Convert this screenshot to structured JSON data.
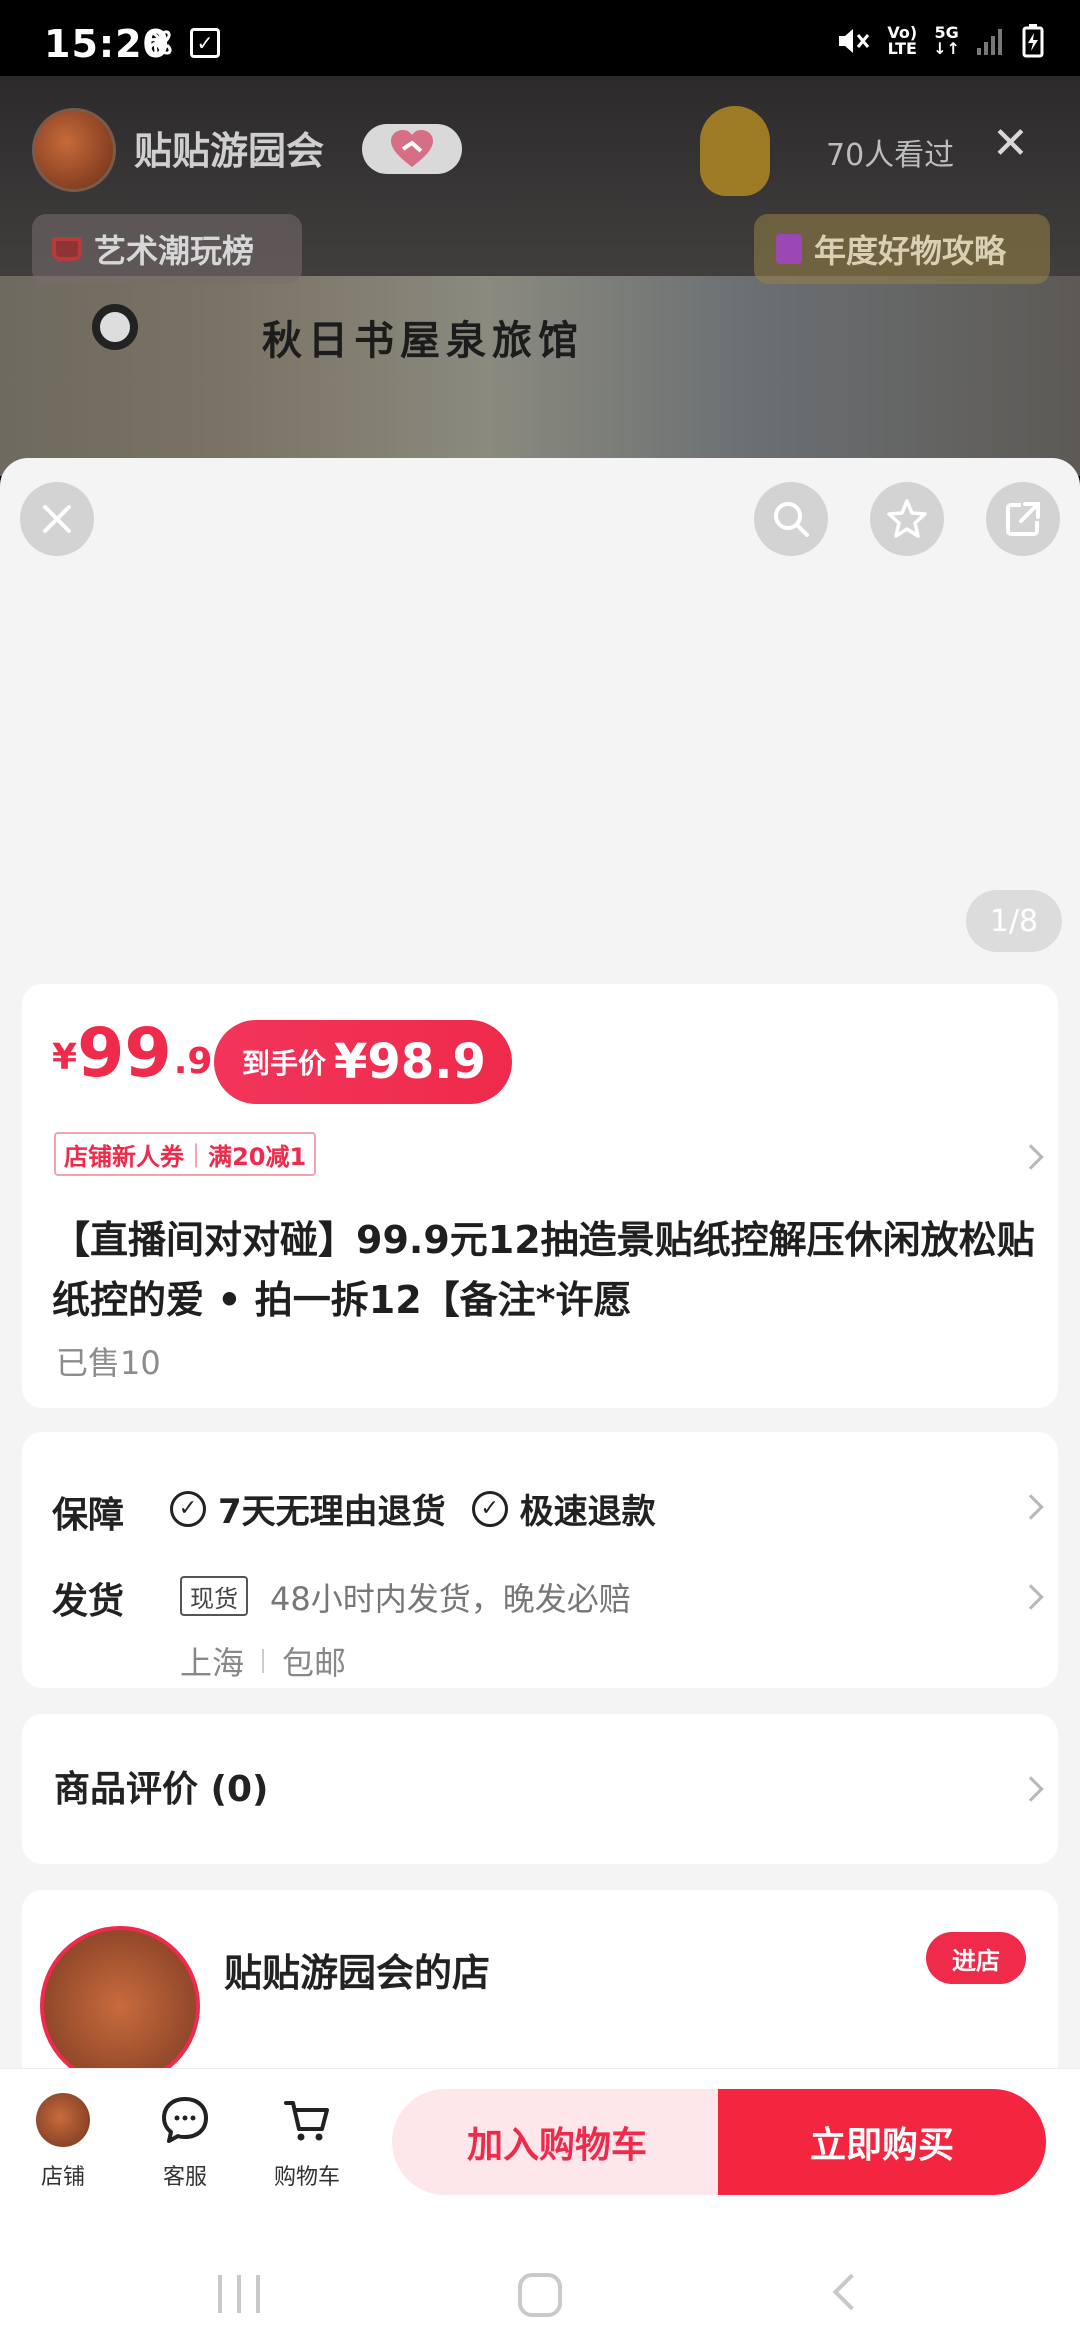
{
  "status_bar": {
    "time": "15:20",
    "network_top": "Vo)",
    "network_bottom": "LTE",
    "signal_label": "5G"
  },
  "live": {
    "host_name": "贴贴游园会",
    "viewers": "70人看过",
    "tag_left": "艺术潮玩榜",
    "tag_right": "年度好物攻略",
    "poster_text": "秋日书屋泉旅馆"
  },
  "gallery": {
    "counter": "1/8"
  },
  "product": {
    "price_symbol": "¥",
    "price_int": "99",
    "price_dec": ".9",
    "final_label": "到手价",
    "final_price": "¥98.9",
    "coupon_left": "店铺新人券",
    "coupon_right": "满20减1",
    "title": "【直播间对对碰】99.9元12抽造景贴纸控解压休闲放松贴纸控的爱 • 拍一拆12【备注*许愿",
    "sold": "已售10"
  },
  "service": {
    "guarantee_label": "保障",
    "guarantee_1": "7天无理由退货",
    "guarantee_2": "极速退款",
    "shipping_label": "发货",
    "stock_tag": "现货",
    "shipping_text": "48小时内发货，晚发必赔",
    "origin": "上海",
    "postage": "包邮"
  },
  "reviews": {
    "label": "商品评价 (0)"
  },
  "shop": {
    "name": "贴贴游园会的店",
    "enter": "进店"
  },
  "bottom_nav": {
    "shop": "店铺",
    "service": "客服",
    "cart": "购物车",
    "add_to_cart": "加入购物车",
    "buy_now": "立即购买"
  }
}
